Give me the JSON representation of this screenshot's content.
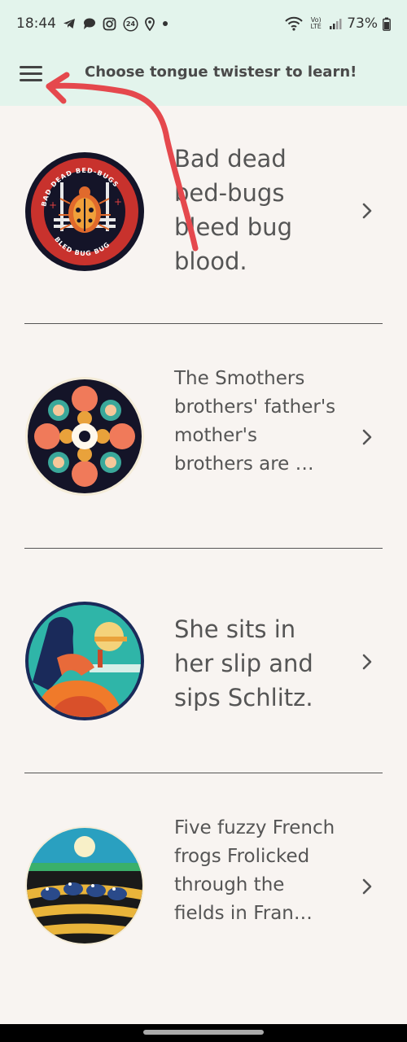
{
  "status_bar": {
    "time": "18:44",
    "notification_icons": [
      "telegram-icon",
      "chat-bubble-icon",
      "instagram-icon",
      "news24-icon",
      "location-icon",
      "dot-icon"
    ],
    "news_badge": "24",
    "battery": "73%",
    "lte_label": "Vo) LTE"
  },
  "app_bar": {
    "title": "Choose tongue twistesr to learn!",
    "background": "#e3f4ec"
  },
  "items": [
    {
      "text": "Bad dead bed-bugs bleed bug blood.",
      "thumb": "bedbug-badge-image"
    },
    {
      "text": "The Smothers brothers' father's mother's brothers are …",
      "thumb": "mandala-image"
    },
    {
      "text": "She sits in her slip and sips Schlitz.",
      "thumb": "woman-drinking-image"
    },
    {
      "text": "Five fuzzy French frogs Frolicked through the fields in Fran…",
      "thumb": "frogs-field-image"
    }
  ],
  "thumbnail_text": {
    "badge_top": "BAD DEAD BED-BUGS",
    "badge_bottom": "BLED BUG BUG"
  },
  "colors": {
    "background": "#f8f4f1",
    "annotation_arrow": "#e5484d"
  }
}
